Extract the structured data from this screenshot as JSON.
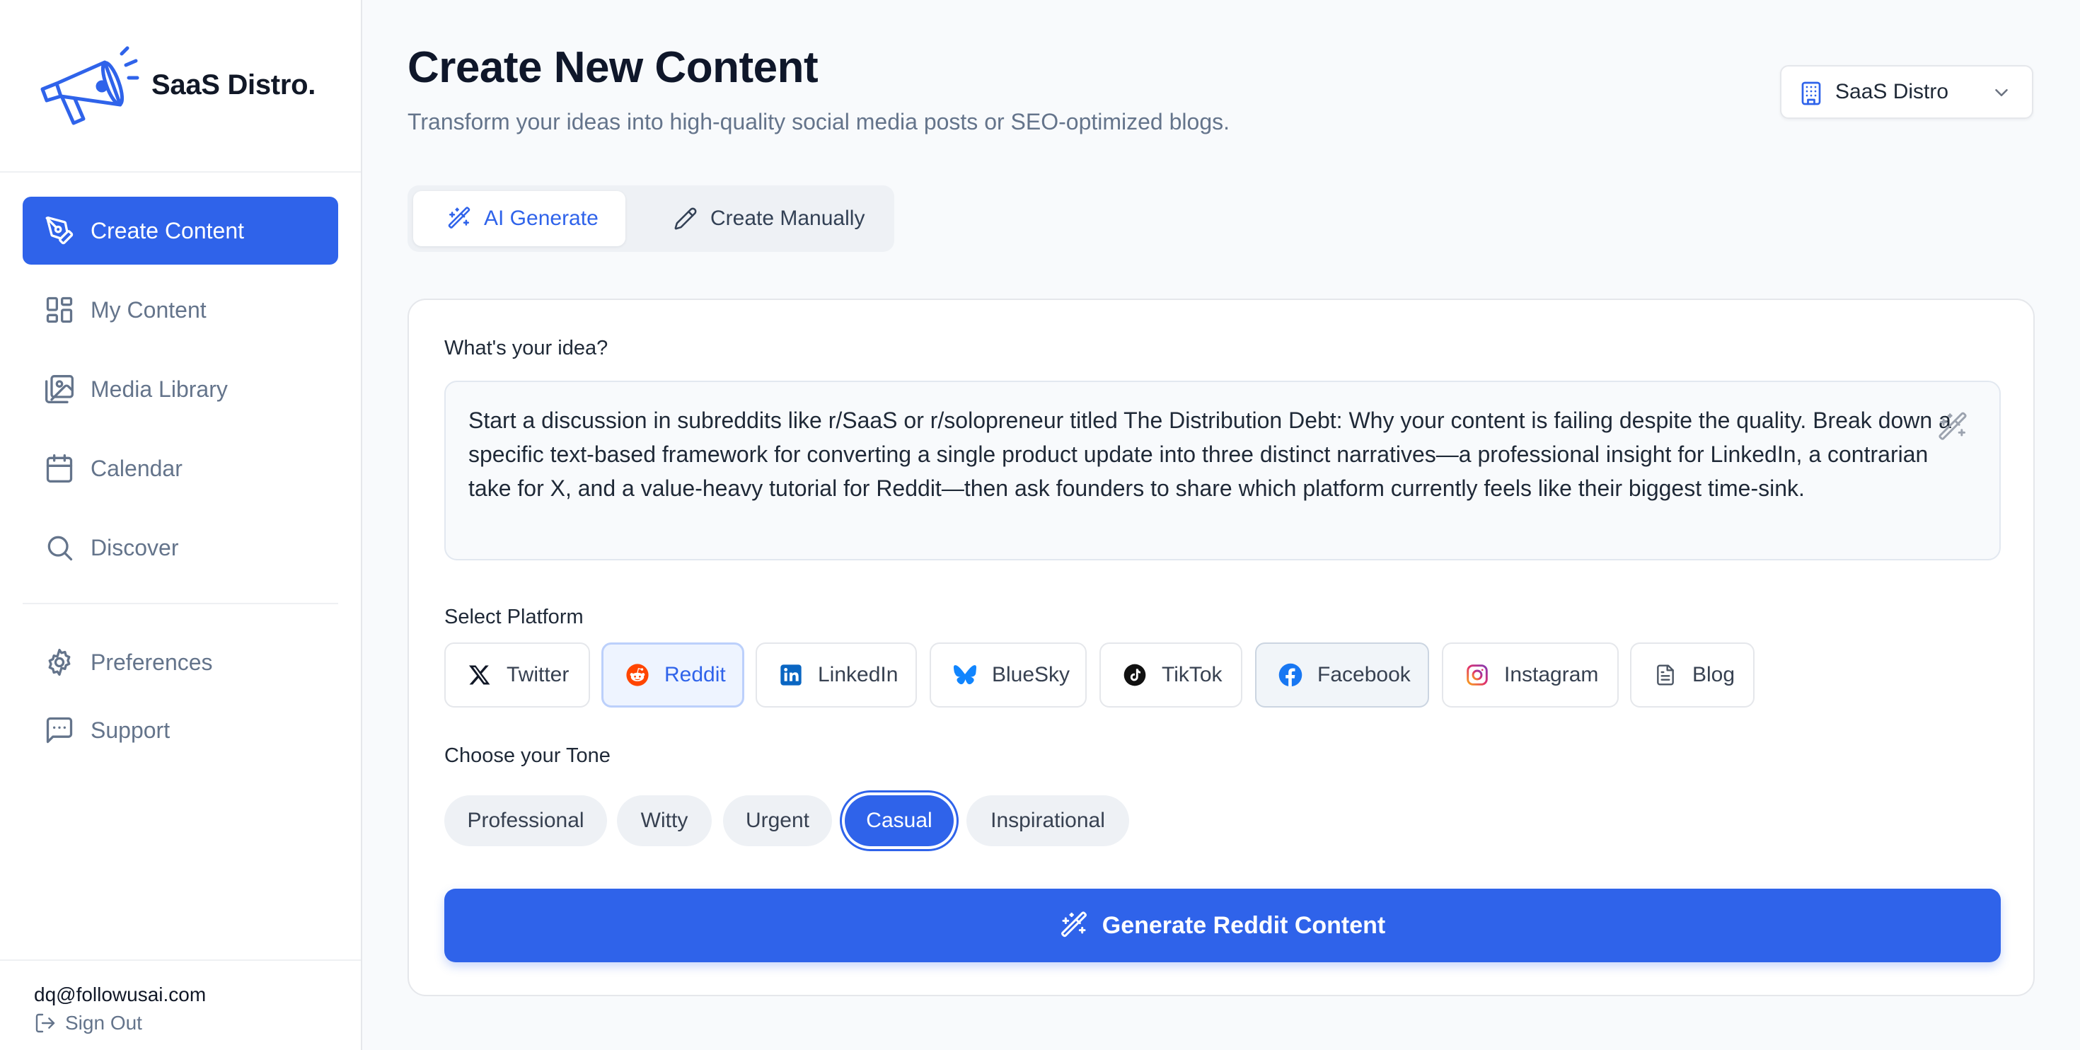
{
  "brand": {
    "name": "SaaS Distro."
  },
  "sidebar": {
    "items": [
      {
        "label": "Create Content",
        "icon": "pen-tool-icon",
        "active": true
      },
      {
        "label": "My Content",
        "icon": "layout-grid-icon"
      },
      {
        "label": "Media Library",
        "icon": "images-icon"
      },
      {
        "label": "Calendar",
        "icon": "calendar-icon"
      },
      {
        "label": "Discover",
        "icon": "search-icon"
      }
    ],
    "secondary": [
      {
        "label": "Preferences",
        "icon": "gear-icon"
      },
      {
        "label": "Support",
        "icon": "message-square-icon"
      }
    ],
    "user": {
      "email": "dq@followusai.com",
      "signout_label": "Sign Out"
    }
  },
  "header": {
    "title": "Create New Content",
    "subtitle": "Transform your ideas into high-quality social media posts or SEO-optimized blogs.",
    "workspace": "SaaS Distro"
  },
  "mode_tabs": [
    {
      "label": "AI Generate",
      "active": true
    },
    {
      "label": "Create Manually",
      "active": false
    }
  ],
  "form": {
    "idea_label": "What's your idea?",
    "idea_value": "Start a discussion in subreddits like r/SaaS or r/solopreneur titled The Distribution Debt: Why your content is failing despite the quality. Break down a specific text-based framework for converting a single product update into three distinct narratives—a professional insight for LinkedIn, a contrarian take for X, and a value-heavy tutorial for Reddit—then ask founders to share which platform currently feels like their biggest time-sink.",
    "platform_label": "Select Platform",
    "platforms": [
      {
        "label": "Twitter"
      },
      {
        "label": "Reddit",
        "selected": true
      },
      {
        "label": "LinkedIn"
      },
      {
        "label": "BlueSky"
      },
      {
        "label": "TikTok"
      },
      {
        "label": "Facebook"
      },
      {
        "label": "Instagram"
      },
      {
        "label": "Blog"
      }
    ],
    "tone_label": "Choose your Tone",
    "tones": [
      {
        "label": "Professional"
      },
      {
        "label": "Witty"
      },
      {
        "label": "Urgent"
      },
      {
        "label": "Casual",
        "selected": true
      },
      {
        "label": "Inspirational"
      }
    ],
    "generate_label": "Generate Reddit Content"
  },
  "colors": {
    "accent": "#2f63ea",
    "reddit": "#ff4500",
    "linkedin": "#0a66c2",
    "bluesky": "#1185fe",
    "facebook": "#1877f2"
  }
}
